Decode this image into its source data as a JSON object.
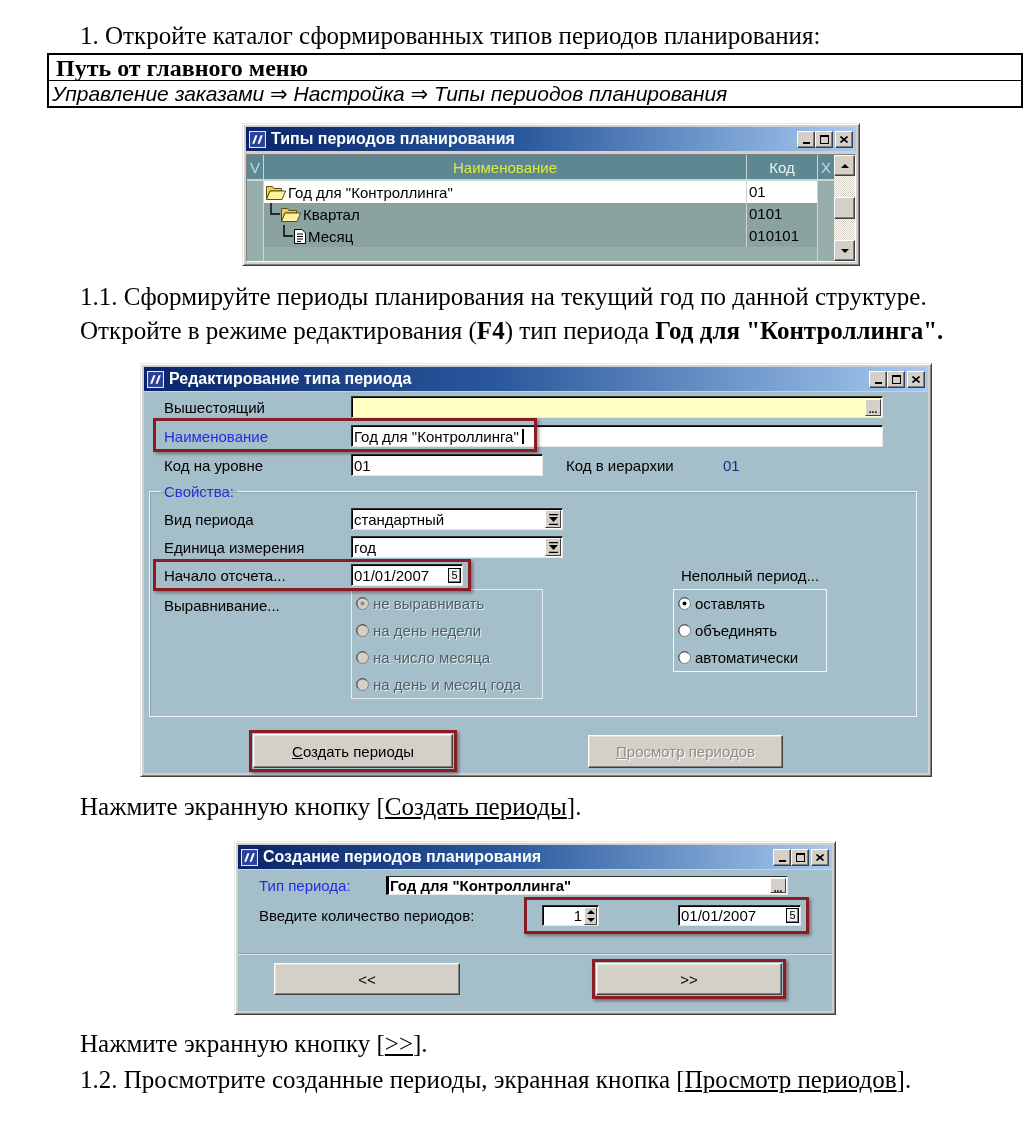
{
  "intro": "1. Откройте каталог сформированных типов периодов планирования:",
  "menu_path": {
    "header": "Путь от главного меню",
    "path": "Управление заказами ⇒ Настройка ⇒ Типы периодов планирования"
  },
  "catalog_window": {
    "title": "Типы периодов планирования",
    "columns": [
      {
        "label": "V",
        "sorted": false
      },
      {
        "label": "Наименование",
        "sorted": true
      },
      {
        "label": "Код",
        "sorted": false
      },
      {
        "label": "X",
        "sorted": false
      }
    ],
    "rows": [
      {
        "name": "Год для \"Контроллинга\"",
        "code": "01",
        "selected": true,
        "children": [
          {
            "name": "Квартал",
            "code": "0101",
            "selected": false,
            "children": [
              {
                "name": "Месяц",
                "code": "010101",
                "selected": false
              }
            ]
          }
        ]
      }
    ]
  },
  "step_1_1": [
    "1.1. Сформируйте периоды планирования на текущий год по данной структуре.",
    "Откройте в режиме редактирования (**F4**) тип периода **Год для \"Контроллинга\".**"
  ],
  "edit_window": {
    "title": "Редактирование типа периода",
    "fields": [
      {
        "kind": "lookup",
        "label": "Вышестоящий",
        "button": "...",
        "focused": false,
        "highlighted": false
      },
      {
        "kind": "text",
        "label": "Наименование",
        "value": "Год для \"Контроллинга\"",
        "focused": true,
        "highlighted": true
      },
      {
        "kind": "code",
        "label": "Код на уровне",
        "value": "01",
        "info_label": "Код в иерархии",
        "info_value": "01",
        "focused": false,
        "highlighted": false
      }
    ],
    "properties": {
      "title": "Свойства:",
      "fields": [
        {
          "kind": "combo",
          "label": "Вид периода",
          "value": "стандартный",
          "highlighted": false
        },
        {
          "kind": "combo",
          "label": "Единица измерения",
          "value": "год",
          "highlighted": false
        },
        {
          "kind": "date",
          "label": "Начало отсчета...",
          "value": "01/01/2007",
          "button": "5",
          "highlighted": true
        }
      ],
      "alignment": {
        "label": "Выравнивание...",
        "disabled": true,
        "options": [
          {
            "label": "не выравнивать",
            "selected": true
          },
          {
            "label": "на день недели",
            "selected": false
          },
          {
            "label": "на число месяца",
            "selected": false
          },
          {
            "label": "на день и месяц года",
            "selected": false
          }
        ]
      },
      "incomplete_period": {
        "label": "Неполный период...",
        "disabled": false,
        "options": [
          {
            "label": "оставлять",
            "selected": true
          },
          {
            "label": "объединять",
            "selected": false
          },
          {
            "label": "автоматически",
            "selected": false
          }
        ]
      }
    },
    "buttons": [
      {
        "label": "Создать периоды",
        "mnemonic": true,
        "disabled": false,
        "highlighted": true
      },
      {
        "label": "Просмотр периодов",
        "mnemonic": true,
        "disabled": true,
        "highlighted": false
      }
    ]
  },
  "instruction_create": {
    "before": "Нажмите экранную кнопку [",
    "link": "Создать периоды",
    "after": "]."
  },
  "create_window": {
    "title": "Создание периодов планирования",
    "type_field": {
      "label": "Тип периода:",
      "value": "Год для \"Контроллинга\"",
      "button": "...",
      "focused": true
    },
    "count_row": {
      "label": "Введите количество периодов:",
      "count": "1",
      "start_date": "01/01/2007",
      "date_button": "5",
      "highlighted": true
    },
    "buttons": [
      {
        "label": "<<",
        "highlighted": false
      },
      {
        "label": ">>",
        "highlighted": true
      }
    ]
  },
  "instruction_next": {
    "before": "Нажмите экранную кнопку [",
    "link": ">>",
    "after": "]."
  },
  "step_1_2": {
    "before": "1.2. Просмотрите созданные периоды, экранная кнопка [",
    "link": "Просмотр периодов",
    "after": "]."
  }
}
